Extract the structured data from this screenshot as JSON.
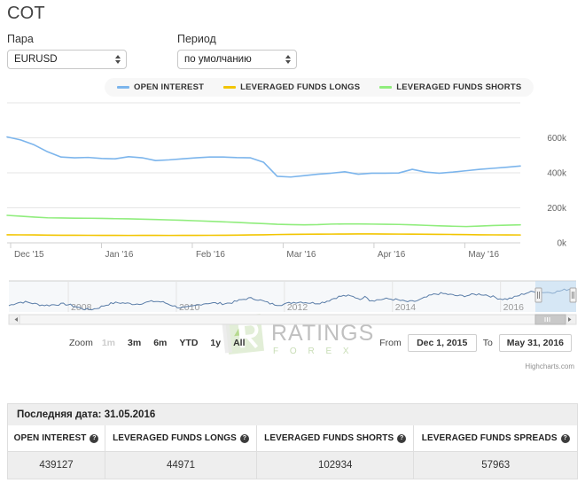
{
  "page_title": "COT",
  "filters": {
    "pair": {
      "label": "Пара",
      "value": "EURUSD"
    },
    "period": {
      "label": "Период",
      "value": "по умолчанию"
    }
  },
  "colors": {
    "open_interest": "#7cb5ec",
    "leveraged_funds_longs": "#f2c500",
    "leveraged_funds_shorts": "#90ed7d",
    "gridline": "#e6e6e6",
    "navigator_series": "#5a7da8",
    "navigator_mask": "#bcd8f0"
  },
  "range_selector": {
    "zoom_label": "Zoom",
    "buttons": [
      {
        "label": "1m",
        "state": "disabled"
      },
      {
        "label": "3m",
        "state": "normal"
      },
      {
        "label": "6m",
        "state": "normal"
      },
      {
        "label": "YTD",
        "state": "normal"
      },
      {
        "label": "1y",
        "state": "normal"
      },
      {
        "label": "All",
        "state": "normal"
      }
    ],
    "from_label": "From",
    "from_value": "Dec 1, 2015",
    "to_label": "To",
    "to_value": "May 31, 2016"
  },
  "credit": "Highcharts.com",
  "watermark": {
    "main": "RATINGS",
    "sub": "F O R E X"
  },
  "table": {
    "last_date": "Последняя дата: 31.05.2016",
    "info_glyph": "?",
    "columns": [
      "OPEN INTEREST",
      "LEVERAGED FUNDS LONGS",
      "LEVERAGED FUNDS SHORTS",
      "LEVERAGED FUNDS SPREADS"
    ],
    "rows": [
      [
        "439127",
        "44971",
        "102934",
        "57963"
      ]
    ]
  },
  "chart_data": {
    "type": "line",
    "title": "COT",
    "xlabel": "",
    "ylabel": "",
    "ylim": [
      0,
      800000
    ],
    "grid": true,
    "legend_position": "top",
    "y_ticks": [
      0,
      200000,
      400000,
      600000
    ],
    "y_tick_labels": [
      "0k",
      "200k",
      "400k",
      "600k"
    ],
    "x_tick_labels": [
      "Dec '15",
      "Jan '16",
      "Feb '16",
      "Mar '16",
      "Apr '16",
      "May '16"
    ],
    "x_range": [
      "2015-12-01",
      "2016-05-31"
    ],
    "series": [
      {
        "name": "OPEN INTEREST",
        "color": "#7cb5ec",
        "values": [
          605000,
          588000,
          560000,
          520000,
          490000,
          486000,
          488000,
          482000,
          480000,
          492000,
          486000,
          470000,
          474000,
          480000,
          486000,
          490000,
          490000,
          487000,
          486000,
          460000,
          380000,
          376000,
          384000,
          392000,
          398000,
          406000,
          392000,
          398000,
          398000,
          399000,
          420000,
          404000,
          398000,
          404000,
          412000,
          420000,
          426000,
          432000,
          439127
        ]
      },
      {
        "name": "LEVERAGED FUNDS LONGS",
        "color": "#f2c500",
        "values": [
          46000,
          45500,
          45000,
          44000,
          43500,
          43200,
          43000,
          42800,
          42500,
          42400,
          42600,
          42500,
          42400,
          42600,
          42800,
          43000,
          43500,
          44000,
          45000,
          46000,
          47500,
          48500,
          49000,
          49500,
          50000,
          50500,
          50800,
          51000,
          50500,
          50000,
          49500,
          49000,
          48500,
          48000,
          47000,
          46000,
          45500,
          45200,
          44971
        ]
      },
      {
        "name": "LEVERAGED FUNDS SHORTS",
        "color": "#90ed7d",
        "values": [
          157000,
          152000,
          147000,
          143000,
          142000,
          141000,
          140500,
          139500,
          138000,
          137000,
          135000,
          133000,
          131000,
          129000,
          126000,
          123000,
          120000,
          117000,
          113000,
          110000,
          106000,
          104000,
          103000,
          104000,
          107000,
          108000,
          108000,
          107000,
          106000,
          105000,
          103000,
          100000,
          97000,
          95000,
          93000,
          96000,
          99000,
          101000,
          102934
        ]
      }
    ],
    "navigator": {
      "x_tick_labels": [
        "2008",
        "2010",
        "2012",
        "2014",
        "2016"
      ],
      "selected_range": [
        "Dec 1, 2015",
        "May 31, 2016"
      ],
      "series_name": "OPEN INTEREST"
    }
  }
}
